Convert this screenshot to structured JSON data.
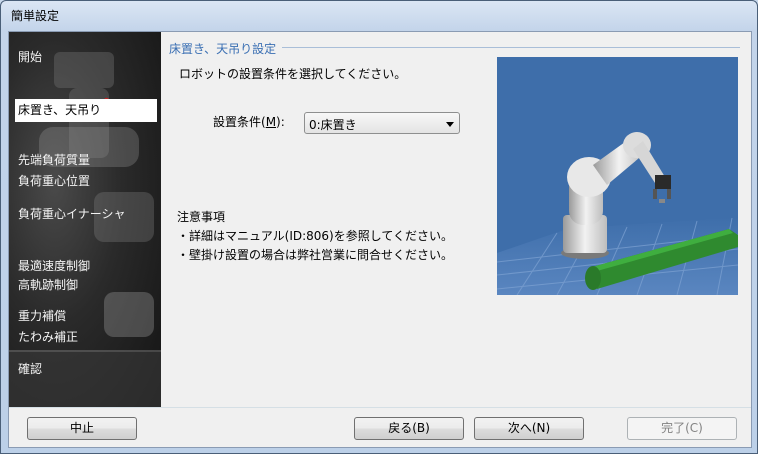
{
  "window": {
    "title": "簡単設定"
  },
  "nav": {
    "items": [
      {
        "label": "開始"
      },
      {
        "label": "床置き、天吊り"
      },
      {
        "label": "先端負荷質量"
      },
      {
        "label": "負荷重心位置"
      },
      {
        "label": "負荷重心イナーシャ"
      },
      {
        "label": "最適速度制御"
      },
      {
        "label": "高軌跡制御"
      },
      {
        "label": "重力補償"
      },
      {
        "label": "たわみ補正"
      },
      {
        "label": "確認"
      }
    ],
    "active_index": 1
  },
  "main": {
    "group_title": "床置き、天吊り設定",
    "instruction": "ロボットの設置条件を選択してください。",
    "condition": {
      "label": "設置条件(",
      "mnemonic": "M",
      "label_suffix": "):",
      "value": "0:床置き"
    },
    "notes": {
      "title": "注意事項",
      "lines": [
        "・詳細はマニュアル(ID:806)を参照してください。",
        "・壁掛け設置の場合は弊社営業に問合せください。"
      ]
    }
  },
  "footer": {
    "cancel": "中止",
    "back": "戻る(B)",
    "next": "次へ(N)",
    "finish": "完了(C)"
  },
  "colors": {
    "accent_title": "#3a6fb3",
    "preview_sky": "#3e6eaa",
    "conveyor": "#2f8a2f"
  }
}
